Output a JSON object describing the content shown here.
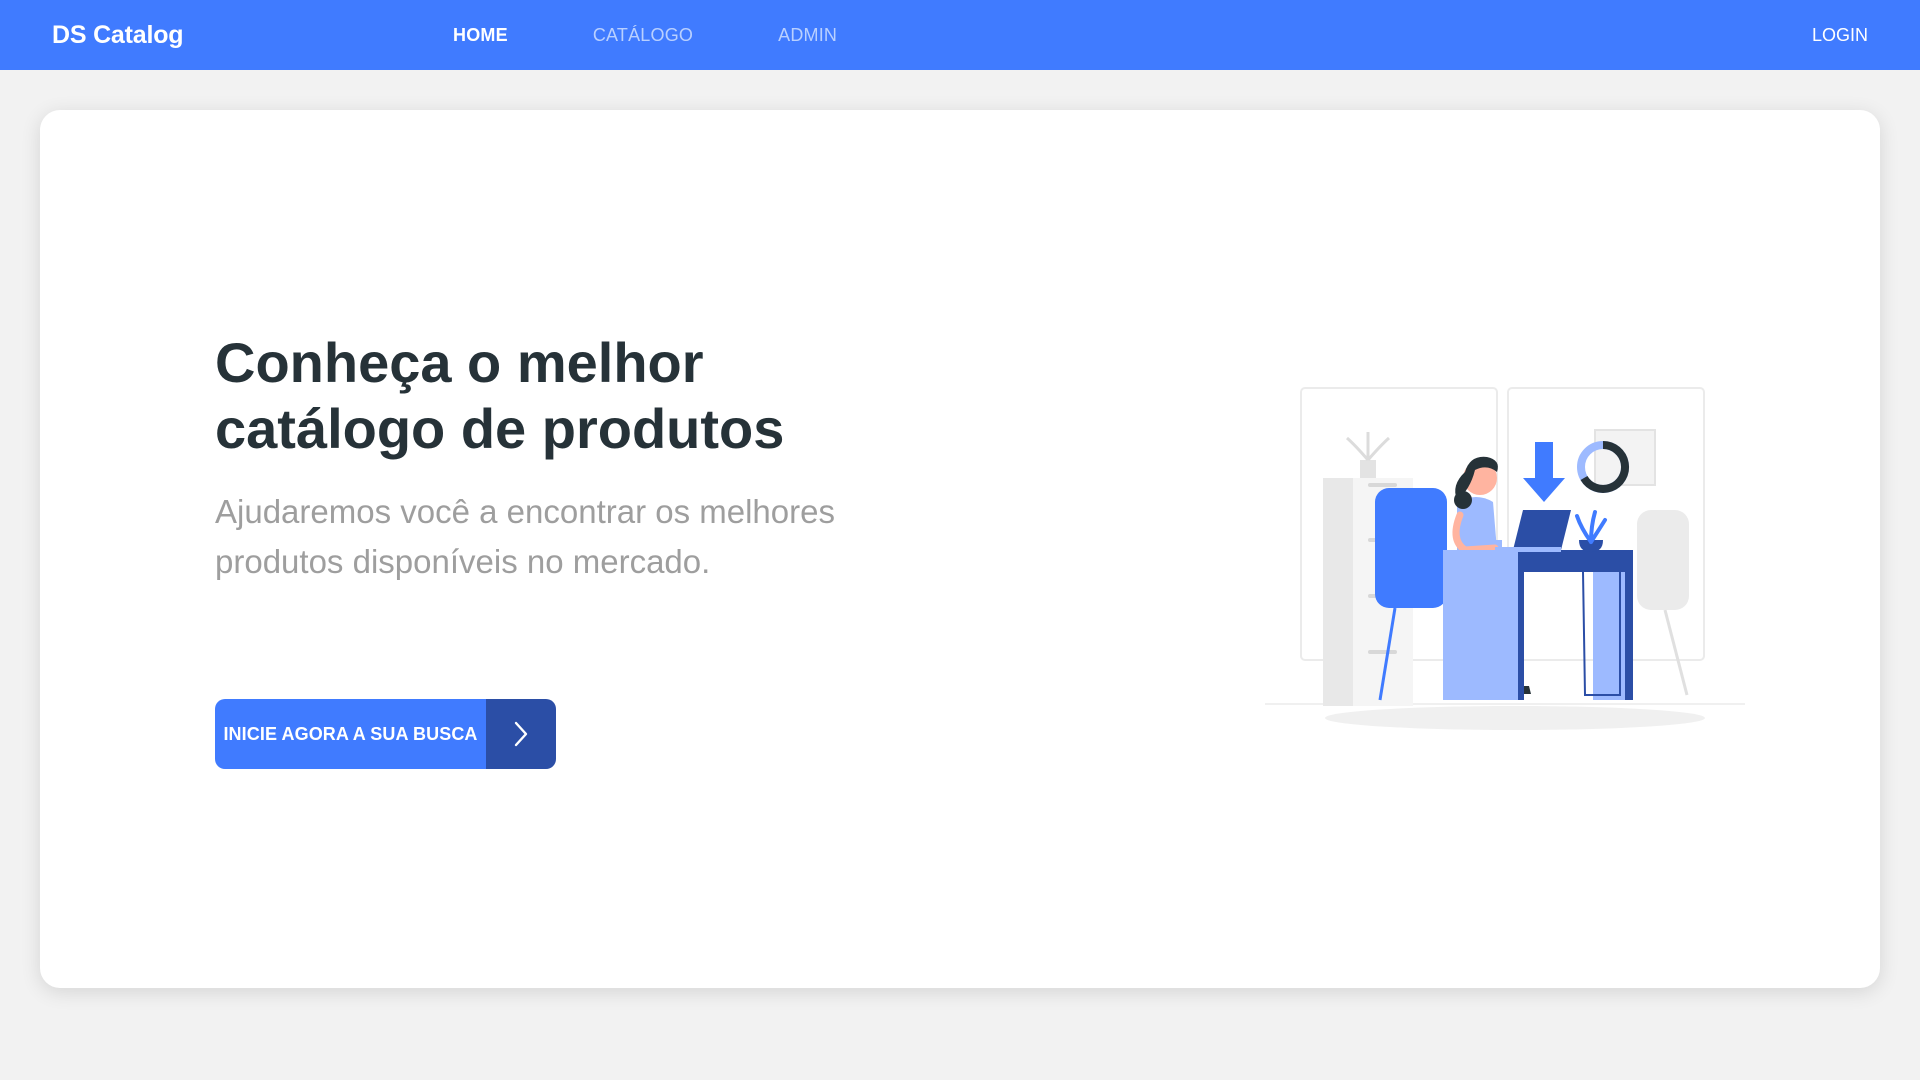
{
  "navbar": {
    "brand": "DS Catalog",
    "links": [
      {
        "label": "HOME",
        "active": true
      },
      {
        "label": "CATÁLOGO",
        "active": false
      },
      {
        "label": "ADMIN",
        "active": false
      }
    ],
    "login": "LOGIN"
  },
  "home": {
    "title_line1": "Conheça o melhor",
    "title_line2": "catálogo de produtos",
    "subtitle_line1": "Ajudaremos você a encontrar os melhores",
    "subtitle_line2": "produtos disponíveis no mercado.",
    "cta_label": "INICIE AGORA A SUA BUSCA",
    "cta_icon": "chevron-right-icon",
    "illustration": "woman-at-desk-illustration"
  },
  "colors": {
    "primary": "#407bff",
    "primary_dark": "#2b4ea6",
    "title": "#263238",
    "subtitle": "#9e9e9e",
    "background": "#f2f2f2",
    "card": "#ffffff"
  }
}
